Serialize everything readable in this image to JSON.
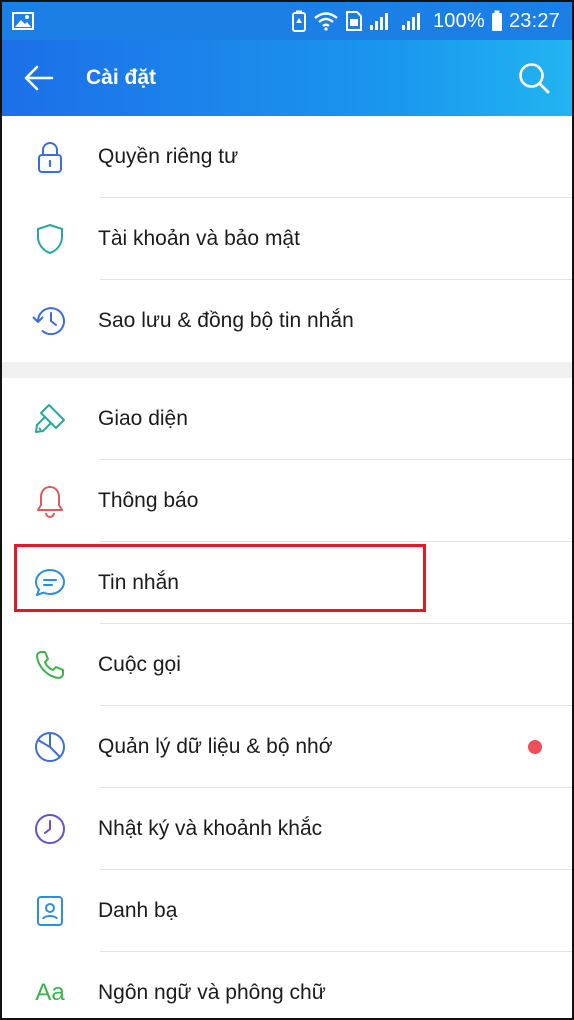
{
  "status_bar": {
    "battery_text": "100%",
    "time": "23:27"
  },
  "header": {
    "title": "Cài đặt"
  },
  "groups": [
    {
      "items": [
        {
          "label": "Quyền riêng tư",
          "icon": "lock-icon"
        },
        {
          "label": "Tài khoản và bảo mật",
          "icon": "shield-icon"
        },
        {
          "label": "Sao lưu & đồng bộ tin nhắn",
          "icon": "history-clock-icon"
        }
      ]
    },
    {
      "items": [
        {
          "label": "Giao diện",
          "icon": "paint-brush-icon"
        },
        {
          "label": "Thông báo",
          "icon": "bell-icon"
        },
        {
          "label": "Tin nhắn",
          "icon": "chat-bubble-icon",
          "highlighted": true
        },
        {
          "label": "Cuộc gọi",
          "icon": "phone-icon"
        },
        {
          "label": "Quản lý dữ liệu & bộ nhớ",
          "icon": "pie-chart-icon",
          "badge_dot": true
        },
        {
          "label": "Nhật ký và khoảnh khắc",
          "icon": "clock-icon"
        },
        {
          "label": "Danh bạ",
          "icon": "contact-card-icon"
        },
        {
          "label": "Ngôn ngữ và phông chữ",
          "icon": "font-aa-icon",
          "icon_text": "Aa"
        }
      ]
    }
  ],
  "colors": {
    "header_start": "#1c6fe8",
    "header_end": "#22b4f1",
    "highlight_border": "#e01b23",
    "badge_dot": "#ef4d5a"
  }
}
